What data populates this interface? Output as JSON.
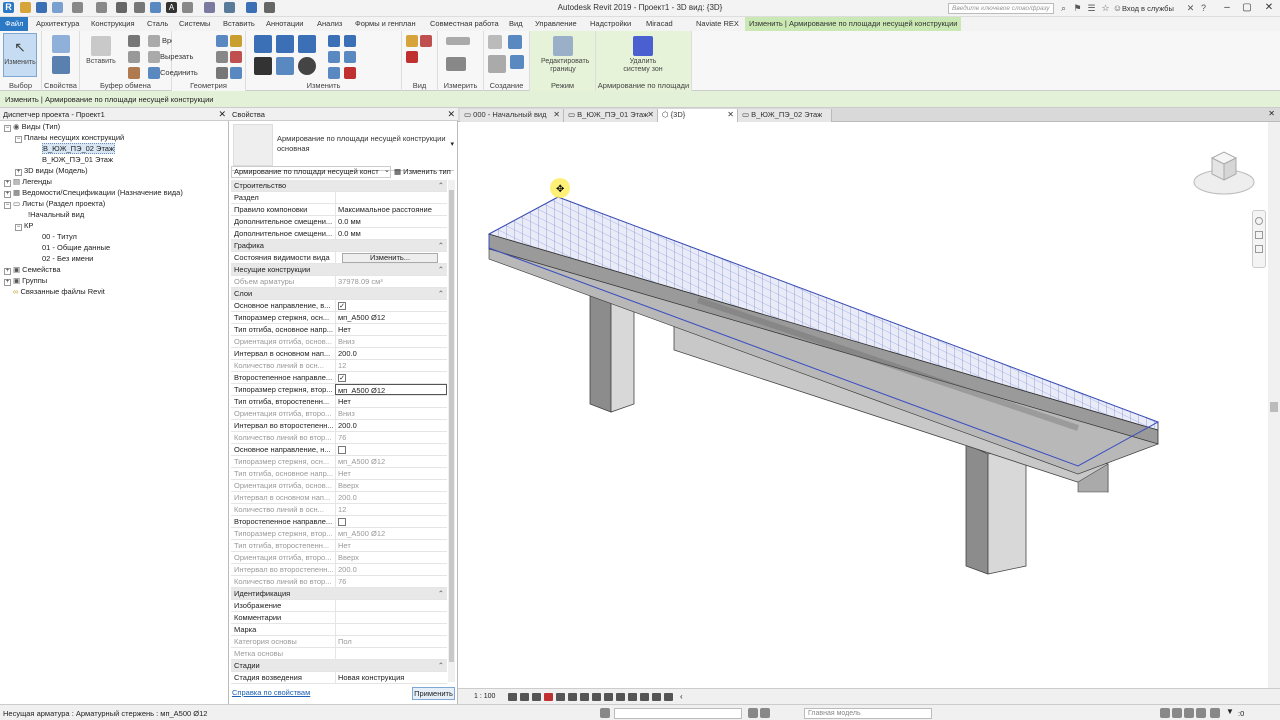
{
  "titlebar": {
    "title": "Autodesk Revit 2019 - Проект1 - 3D вид: {3D}",
    "search_placeholder": "Введите ключевое слово/фразу",
    "login": "Вход в службы",
    "app_letter": "R"
  },
  "menu": {
    "tabs": [
      "Файл",
      "Архитектура",
      "Конструкция",
      "Сталь",
      "Системы",
      "Вставить",
      "Аннотации",
      "Анализ",
      "Формы и генплан",
      "Совместная работа",
      "Вид",
      "Управление",
      "Надстройки",
      "Miracad",
      "Naviate REX"
    ],
    "context_tab": "Изменить | Армирование по площади несущей конструкции"
  },
  "ribbon": {
    "modify_label": "Изменить",
    "paste_label": "Вставить",
    "cut_label": "Вырезать",
    "join_label": "Соединить",
    "vrezka_label": "Врезка",
    "edit_boundary_label": "Редактировать границу",
    "delete_zone_label": "Удалить систему зон",
    "groups": [
      "Выбор",
      "Свойства",
      "Буфер обмена",
      "Геометрия",
      "Изменить",
      "Вид",
      "Измерить",
      "Создание",
      "Режим",
      "Армирование по площади"
    ]
  },
  "optionsbar": {
    "text": "Изменить | Армирование по площади несущей конструкции"
  },
  "browser": {
    "title": "Диспетчер проекта - Проект1",
    "nodes": [
      {
        "label": "Виды (Тип)",
        "toggle": "−"
      },
      {
        "label": "Планы несущих конструкций",
        "toggle": "−"
      },
      {
        "label": "В_ЮЖ_ПЭ_02 Этаж",
        "toggle": ""
      },
      {
        "label": "В_ЮЖ_ПЭ_01 Этаж",
        "toggle": ""
      },
      {
        "label": "3D виды (Модель)",
        "toggle": "+"
      },
      {
        "label": "Легенды",
        "toggle": "+"
      },
      {
        "label": "Ведомости/Спецификации (Назначение вида)",
        "toggle": "+"
      },
      {
        "label": "Листы (Раздел проекта)",
        "toggle": "−"
      },
      {
        "label": "!Начальный вид",
        "toggle": ""
      },
      {
        "label": "КР",
        "toggle": "−"
      },
      {
        "label": "00 - Титул",
        "toggle": ""
      },
      {
        "label": "01 - Общие данные",
        "toggle": ""
      },
      {
        "label": "02 - Без имени",
        "toggle": ""
      },
      {
        "label": "Семейства",
        "toggle": "+"
      },
      {
        "label": "Группы",
        "toggle": "+"
      },
      {
        "label": "Связанные файлы Revit",
        "toggle": ""
      }
    ]
  },
  "properties": {
    "title": "Свойства",
    "type_name": "Армирование по площади несущей конструкции основная",
    "type_selector": "Армирование по площади несущей конст",
    "edit_type": "Изменить тип",
    "rows": [
      {
        "k": "Строительство",
        "v": "⌃",
        "kind": "cat"
      },
      {
        "k": "Раздел",
        "v": ""
      },
      {
        "k": "Правило компоновки",
        "v": "Максимальное расстояние"
      },
      {
        "k": "Дополнительное смещени...",
        "v": "0.0 мм"
      },
      {
        "k": "Дополнительное смещени...",
        "v": "0.0 мм"
      },
      {
        "k": "Графика",
        "v": "⌃",
        "kind": "cat"
      },
      {
        "k": "Состояния видимости вида",
        "v": "Изменить...",
        "kind": "btn"
      },
      {
        "k": "Несущие конструкции",
        "v": "⌃",
        "kind": "cat"
      },
      {
        "k": "Объем арматуры",
        "v": "37978.09 см³",
        "kind": "dim"
      },
      {
        "k": "Слои",
        "v": "⌃",
        "kind": "cat"
      },
      {
        "k": "Основное направление, в...",
        "v": "✓",
        "kind": "chk"
      },
      {
        "k": "Типоразмер стержня, осн...",
        "v": "мп_A500 Ø12"
      },
      {
        "k": "Тип отгиба, основное напр...",
        "v": "Нет"
      },
      {
        "k": "Ориентация отгиба, основ...",
        "v": "Вниз",
        "kind": "dim"
      },
      {
        "k": "Интервал в основном нап...",
        "v": "200.0"
      },
      {
        "k": "Количество линий в осн...",
        "v": "12",
        "kind": "dim"
      },
      {
        "k": "Второстепенное направле...",
        "v": "✓",
        "kind": "chk"
      },
      {
        "k": "Типоразмер стержня, втор...",
        "v": "мп_A500 Ø12",
        "kind": "box"
      },
      {
        "k": "Тип отгиба, второстепенн...",
        "v": "Нет"
      },
      {
        "k": "Ориентация отгиба, второ...",
        "v": "Вниз",
        "kind": "dim"
      },
      {
        "k": "Интервал во второстепенн...",
        "v": "200.0"
      },
      {
        "k": "Количество линий во втор...",
        "v": "76",
        "kind": "dim"
      },
      {
        "k": "Основное направление, н...",
        "v": "",
        "kind": "chk"
      },
      {
        "k": "Типоразмер стержня, осн...",
        "v": "мп_A500 Ø12",
        "kind": "dim"
      },
      {
        "k": "Тип отгиба, основное напр...",
        "v": "Нет",
        "kind": "dim"
      },
      {
        "k": "Ориентация отгиба, основ...",
        "v": "Вверх",
        "kind": "dim"
      },
      {
        "k": "Интервал в основном нап...",
        "v": "200.0",
        "kind": "dim"
      },
      {
        "k": "Количество линий в осн...",
        "v": "12",
        "kind": "dim"
      },
      {
        "k": "Второстепенное направле...",
        "v": "",
        "kind": "chk"
      },
      {
        "k": "Типоразмер стержня, втор...",
        "v": "мп_A500 Ø12",
        "kind": "dim"
      },
      {
        "k": "Тип отгиба, второстепенн...",
        "v": "Нет",
        "kind": "dim"
      },
      {
        "k": "Ориентация отгиба, второ...",
        "v": "Вверх",
        "kind": "dim"
      },
      {
        "k": "Интервал во второстепенн...",
        "v": "200.0",
        "kind": "dim"
      },
      {
        "k": "Количество линий во втор...",
        "v": "76",
        "kind": "dim"
      },
      {
        "k": "Идентификация",
        "v": "⌃",
        "kind": "cat"
      },
      {
        "k": "Изображение",
        "v": ""
      },
      {
        "k": "Комментарии",
        "v": ""
      },
      {
        "k": "Марка",
        "v": ""
      },
      {
        "k": "Категория основы",
        "v": "Пол",
        "kind": "dim"
      },
      {
        "k": "Метка основы",
        "v": "",
        "kind": "dim"
      },
      {
        "k": "Стадии",
        "v": "⌃",
        "kind": "cat"
      },
      {
        "k": "Стадия возведения",
        "v": "Новая конструкция"
      }
    ],
    "help_link": "Справка по свойствам",
    "apply": "Применить"
  },
  "view_tabs": [
    {
      "label": "000 - Начальный вид",
      "active": false
    },
    {
      "label": "В_ЮЖ_ПЭ_01 Этаж",
      "active": false
    },
    {
      "label": "{3D}",
      "active": true
    },
    {
      "label": "В_ЮЖ_ПЭ_02 Этаж",
      "active": false
    }
  ],
  "viewbar": {
    "scale": "1 : 100"
  },
  "statusbar": {
    "message": "Несущая арматура : Арматурный стержень : мп_A500 Ø12",
    "model": "Главная модель",
    "filter_count": ":0"
  },
  "colors": {
    "file_tab": "#2b78c5",
    "context_tab": "#c9e8b3",
    "slab_mesh": "#4a5fd0"
  }
}
